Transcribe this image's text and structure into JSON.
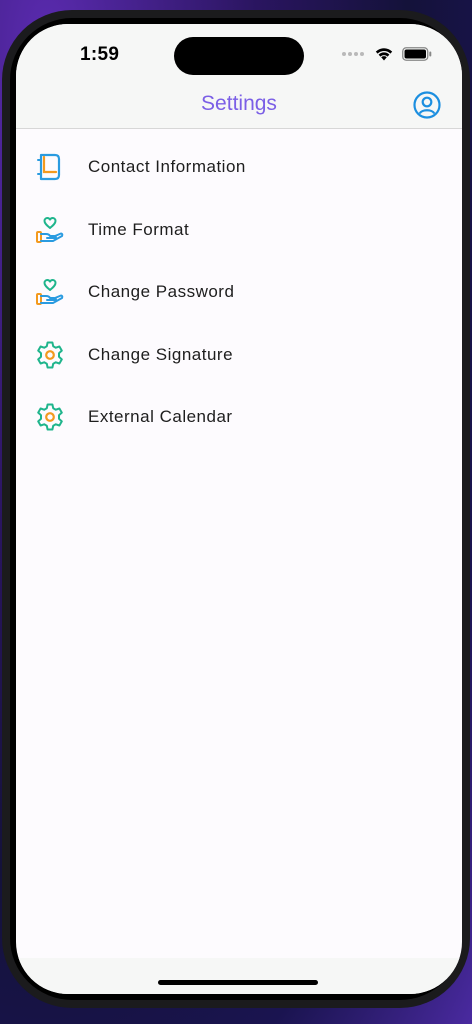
{
  "status_bar": {
    "time": "1:59"
  },
  "nav": {
    "title": "Settings",
    "profile_icon": "person-circle-icon"
  },
  "settings_items": [
    {
      "label": "Contact Information",
      "icon": "contact-book-icon"
    },
    {
      "label": "Time Format",
      "icon": "heart-hand-icon"
    },
    {
      "label": "Change Password",
      "icon": "heart-hand-icon"
    },
    {
      "label": "Change Signature",
      "icon": "gear-icon"
    },
    {
      "label": "External Calendar",
      "icon": "gear-icon"
    }
  ],
  "colors": {
    "accent": "#7b5fe6",
    "icon_blue": "#2a9be0",
    "icon_orange": "#f39a1e",
    "icon_green": "#1fb58c"
  }
}
